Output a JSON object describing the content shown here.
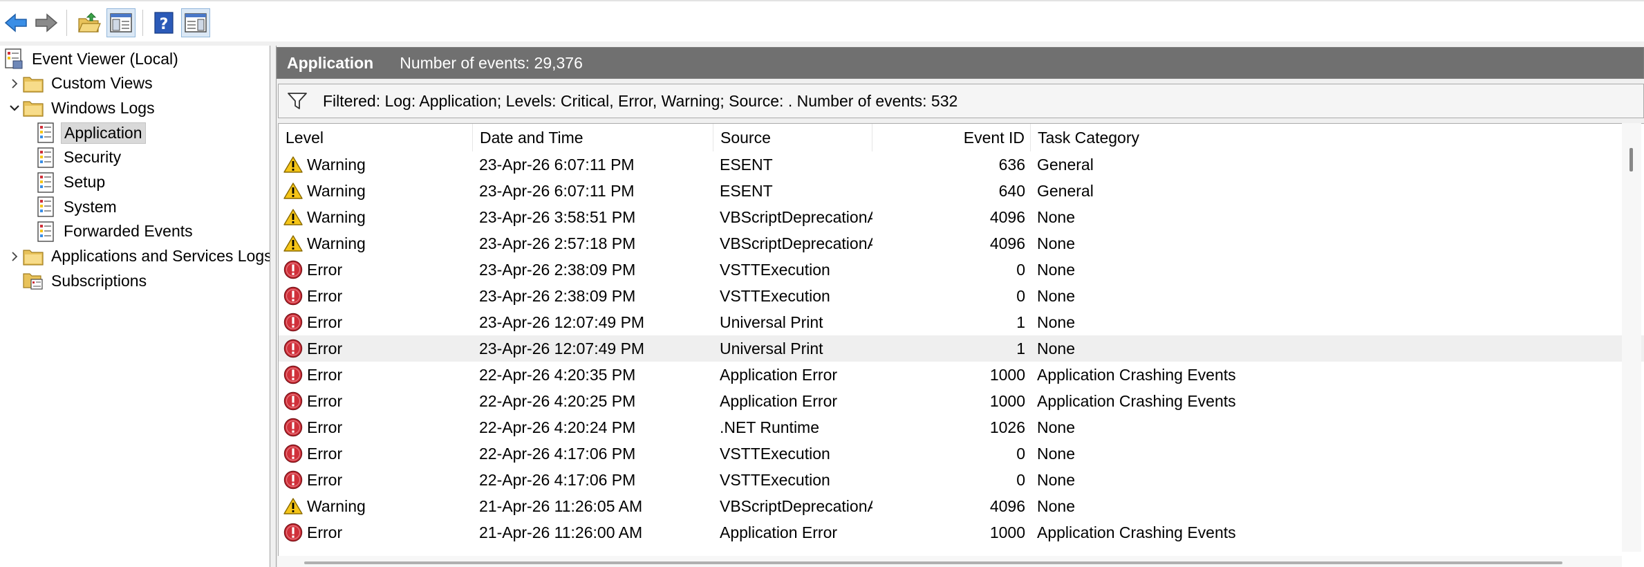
{
  "colors": {
    "header_bg": "#707070",
    "selected_bg": "#d9d9d9",
    "warning_yellow": "#f5c518",
    "error_red": "#d0303a",
    "nav_blue": "#3a8ee6"
  },
  "toolbar": {
    "buttons": [
      {
        "icon": "back-arrow-icon"
      },
      {
        "icon": "forward-arrow-icon"
      },
      {
        "icon": "open-folder-icon"
      },
      {
        "icon": "show-hide-console-tree-icon"
      },
      {
        "icon": "help-icon"
      },
      {
        "icon": "show-hide-action-pane-icon"
      }
    ]
  },
  "tree": {
    "items": [
      {
        "label": "Event Viewer (Local)",
        "icon": "event-viewer-icon",
        "chevron": "",
        "indent": 0
      },
      {
        "label": "Custom Views",
        "icon": "folder-icon",
        "chevron": "›",
        "indent": 1
      },
      {
        "label": "Windows Logs",
        "icon": "folder-icon",
        "chevron": "⌄",
        "indent": 1
      },
      {
        "label": "Application",
        "icon": "log-icon",
        "chevron": "",
        "indent": 2,
        "selected": true
      },
      {
        "label": "Security",
        "icon": "log-icon",
        "chevron": "",
        "indent": 2
      },
      {
        "label": "Setup",
        "icon": "log-icon",
        "chevron": "",
        "indent": 2
      },
      {
        "label": "System",
        "icon": "log-icon",
        "chevron": "",
        "indent": 2
      },
      {
        "label": "Forwarded Events",
        "icon": "log-icon",
        "chevron": "",
        "indent": 2
      },
      {
        "label": "Applications and Services Logs",
        "icon": "folder-icon",
        "chevron": "›",
        "indent": 1
      },
      {
        "label": "Subscriptions",
        "icon": "subscriptions-icon",
        "chevron": "",
        "indent": 1
      }
    ]
  },
  "header": {
    "title": "Application",
    "count": "Number of events: 29,376"
  },
  "filter": {
    "icon": "filter-funnel-icon",
    "text": "Filtered: Log: Application; Levels: Critical, Error, Warning; Source: . Number of events: 532"
  },
  "grid": {
    "columns": [
      "Level",
      "Date and Time",
      "Source",
      "Event ID",
      "Task Category"
    ],
    "rows": [
      {
        "level": "Warning",
        "date": "23-Apr-26 6:07:11 PM",
        "source": "ESENT",
        "event_id": "636",
        "task": "General"
      },
      {
        "level": "Warning",
        "date": "23-Apr-26 6:07:11 PM",
        "source": "ESENT",
        "event_id": "640",
        "task": "General"
      },
      {
        "level": "Warning",
        "date": "23-Apr-26 3:58:51 PM",
        "source": "VBScriptDeprecationAlert",
        "event_id": "4096",
        "task": "None"
      },
      {
        "level": "Warning",
        "date": "23-Apr-26 2:57:18 PM",
        "source": "VBScriptDeprecationAlert",
        "event_id": "4096",
        "task": "None"
      },
      {
        "level": "Error",
        "date": "23-Apr-26 2:38:09 PM",
        "source": "VSTTExecution",
        "event_id": "0",
        "task": "None"
      },
      {
        "level": "Error",
        "date": "23-Apr-26 2:38:09 PM",
        "source": "VSTTExecution",
        "event_id": "0",
        "task": "None"
      },
      {
        "level": "Error",
        "date": "23-Apr-26 12:07:49 PM",
        "source": "Universal Print",
        "event_id": "1",
        "task": "None"
      },
      {
        "level": "Error",
        "date": "23-Apr-26 12:07:49 PM",
        "source": "Universal Print",
        "event_id": "1",
        "task": "None",
        "highlighted": true
      },
      {
        "level": "Error",
        "date": "22-Apr-26 4:20:35 PM",
        "source": "Application Error",
        "event_id": "1000",
        "task": "Application Crashing Events"
      },
      {
        "level": "Error",
        "date": "22-Apr-26 4:20:25 PM",
        "source": "Application Error",
        "event_id": "1000",
        "task": "Application Crashing Events"
      },
      {
        "level": "Error",
        "date": "22-Apr-26 4:20:24 PM",
        "source": ".NET Runtime",
        "event_id": "1026",
        "task": "None"
      },
      {
        "level": "Error",
        "date": "22-Apr-26 4:17:06 PM",
        "source": "VSTTExecution",
        "event_id": "0",
        "task": "None"
      },
      {
        "level": "Error",
        "date": "22-Apr-26 4:17:06 PM",
        "source": "VSTTExecution",
        "event_id": "0",
        "task": "None"
      },
      {
        "level": "Warning",
        "date": "21-Apr-26 11:26:05 AM",
        "source": "VBScriptDeprecationAlert",
        "event_id": "4096",
        "task": "None"
      },
      {
        "level": "Error",
        "date": "21-Apr-26 11:26:00 AM",
        "source": "Application Error",
        "event_id": "1000",
        "task": "Application Crashing Events"
      }
    ]
  }
}
